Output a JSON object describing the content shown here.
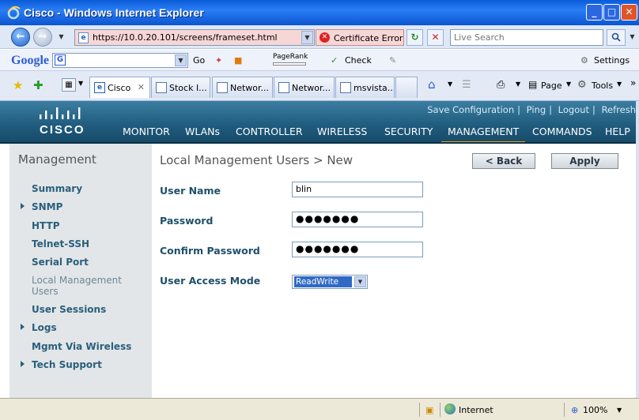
{
  "window": {
    "title": "Cisco - Windows Internet Explorer",
    "min_label": "_",
    "max_label": "□",
    "close_label": "✕"
  },
  "addressbar": {
    "url": "https://10.0.20.101/screens/frameset.html",
    "cert_error": "Certificate Error",
    "search_placeholder": "Live Search",
    "back_glyph": "←",
    "forward_glyph": "→",
    "refresh_glyph": "↻",
    "stop_glyph": "✕"
  },
  "google_toolbar": {
    "logo": "Google",
    "search_value": "",
    "go_label": "Go",
    "pagerank_label": "PageRank",
    "check_label": "Check",
    "settings_label": "Settings"
  },
  "tabs": [
    {
      "label": "Cisco",
      "active": true
    },
    {
      "label": "Stock I..."
    },
    {
      "label": "Networ..."
    },
    {
      "label": "Networ..."
    },
    {
      "label": "msvista..."
    }
  ],
  "ie_tools": {
    "page_label": "Page",
    "tools_label": "Tools"
  },
  "header": {
    "logo_text": "CISCO",
    "links": [
      "Save Configuration",
      "Ping",
      "Logout",
      "Refresh"
    ],
    "menu": [
      "MONITOR",
      "WLANs",
      "CONTROLLER",
      "WIRELESS",
      "SECURITY",
      "MANAGEMENT",
      "COMMANDS",
      "HELP"
    ],
    "active_menu": "MANAGEMENT"
  },
  "sidebar": {
    "title": "Management",
    "items": [
      {
        "label": "Summary",
        "expandable": false
      },
      {
        "label": "SNMP",
        "expandable": true
      },
      {
        "label": "HTTP",
        "expandable": false
      },
      {
        "label": "Telnet-SSH",
        "expandable": false
      },
      {
        "label": "Serial Port",
        "expandable": false
      },
      {
        "label": "Local Management",
        "label2": "Users",
        "expandable": false,
        "selected": true
      },
      {
        "label": "User Sessions",
        "expandable": false
      },
      {
        "label": "Logs",
        "expandable": true
      },
      {
        "label": "Mgmt Via Wireless",
        "expandable": false
      },
      {
        "label": "Tech Support",
        "expandable": true
      }
    ]
  },
  "form": {
    "page_title": "Local Management Users > New",
    "back_label": "< Back",
    "apply_label": "Apply",
    "user_name_label": "User Name",
    "user_name_value": "blin",
    "password_label": "Password",
    "password_value": "●●●●●●●",
    "confirm_label": "Confirm Password",
    "confirm_value": "●●●●●●●",
    "access_mode_label": "User Access Mode",
    "access_mode_value": "ReadWrite"
  },
  "statusbar": {
    "zone": "Internet",
    "zoom": "100%"
  },
  "colors": {
    "titlebar": "#0a5bd8",
    "header": "#1f5a7c",
    "active_tab_accent": "#e9a420",
    "sidebar_bg": "#e2e6e8",
    "label_color": "#1f4f6b"
  }
}
